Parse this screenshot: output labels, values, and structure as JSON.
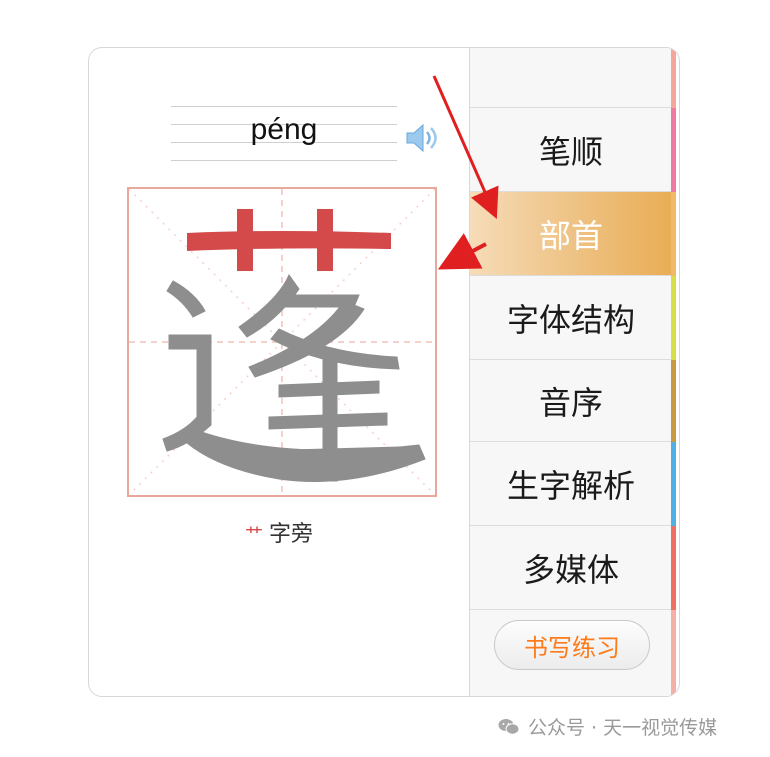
{
  "character": {
    "pinyin": "péng",
    "glyph": "蓬",
    "radical": "艹",
    "radical_label": "字旁"
  },
  "menu": {
    "items": [
      {
        "label": ""
      },
      {
        "label": "笔顺"
      },
      {
        "label": "部首"
      },
      {
        "label": "字体结构"
      },
      {
        "label": "音序"
      },
      {
        "label": "生字解析"
      },
      {
        "label": "多媒体"
      }
    ],
    "active_index": 2,
    "practice_label": "书写练习"
  },
  "colors": {
    "radical_highlight": "#d44a4a",
    "rest_of_glyph": "#8e8e8e",
    "grid_border": "#e6a99c",
    "active_tab": "#e9ad55",
    "practice_text": "#ff7a1a",
    "stripe": [
      "#f4a69a",
      "#f07aa0",
      "#f2b968",
      "#d6df47",
      "#c99a3f",
      "#4fb0e6",
      "#ef6f64",
      "#f4b0a8"
    ]
  },
  "icons": {
    "speaker": "speaker-icon",
    "wechat": "wechat-icon"
  },
  "footer": {
    "text": "公众号 · 天一视觉传媒"
  }
}
